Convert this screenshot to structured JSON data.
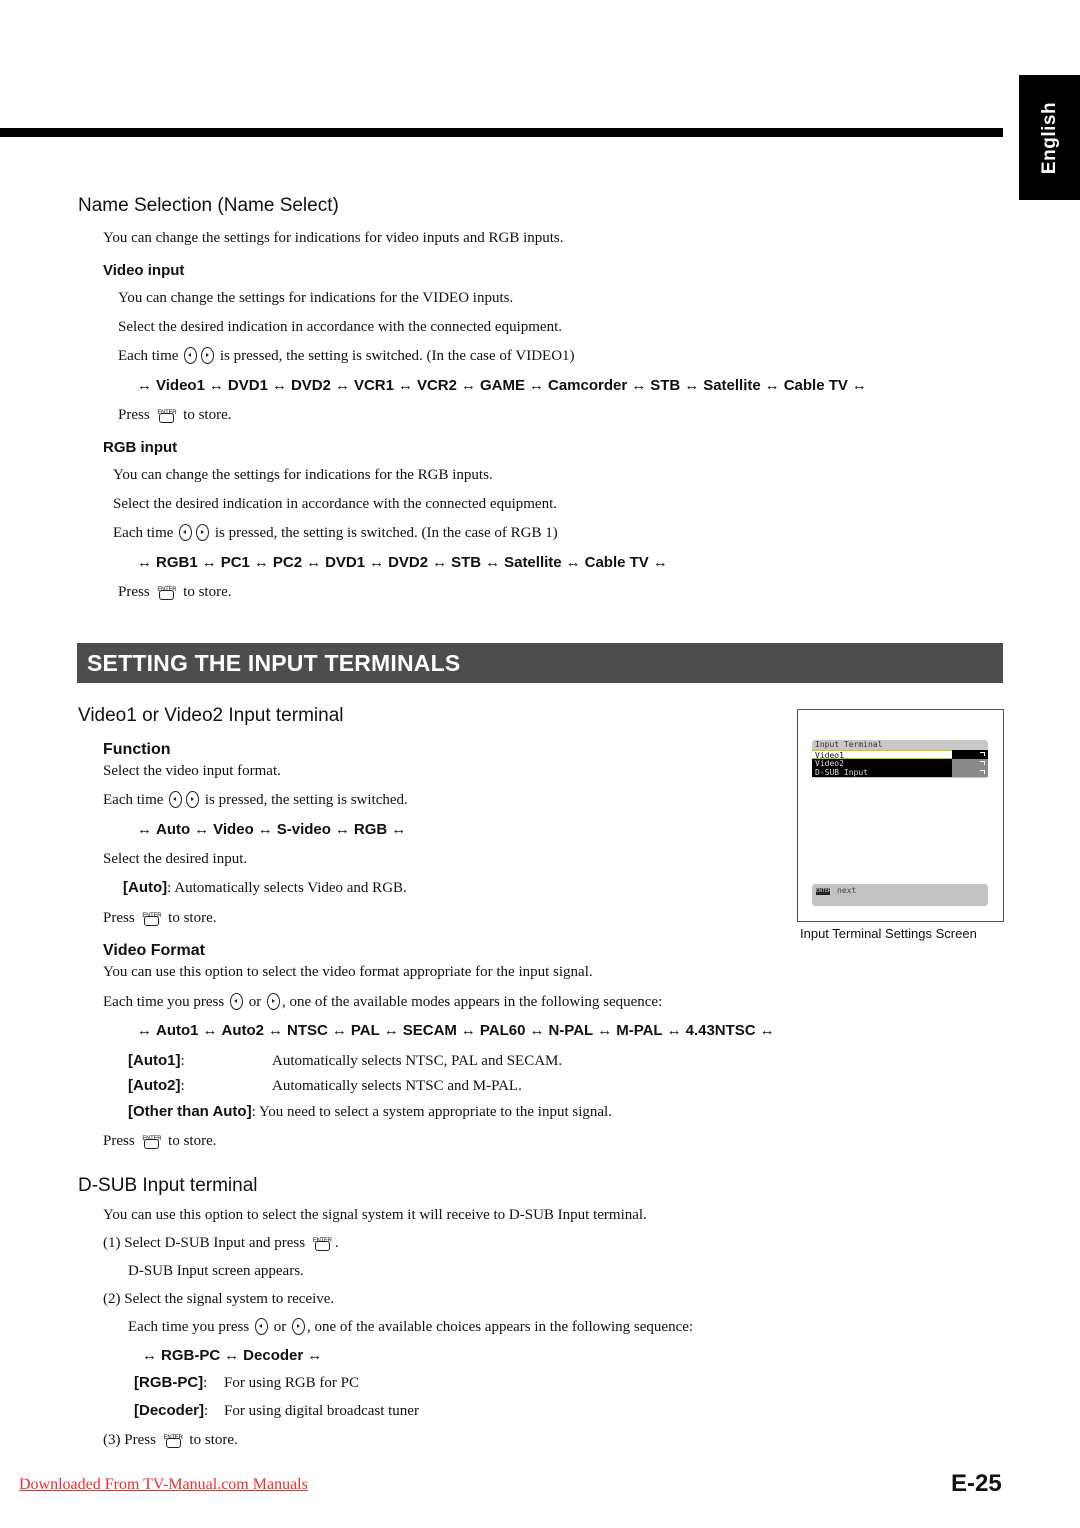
{
  "language_tab": "English",
  "name_selection": {
    "title": "Name Selection (Name Select)",
    "intro": "You can change the settings for indications for video inputs and RGB inputs.",
    "video_input": {
      "heading": "Video input",
      "line1": "You can change the settings for indications for the VIDEO inputs.",
      "line2": "Select the desired indication in accordance with the connected equipment.",
      "each_time_prefix": "Each time",
      "each_time_suffix": "is pressed, the setting is switched. (In the case of VIDEO1)",
      "sequence": [
        "Video1",
        "DVD1",
        "DVD2",
        "VCR1",
        "VCR2",
        "GAME",
        "Camcorder",
        "STB",
        "Satellite",
        "Cable TV"
      ],
      "press_prefix": "Press",
      "press_suffix": "to store."
    },
    "rgb_input": {
      "heading": "RGB input",
      "line1": "You can change the settings for indications for the RGB inputs.",
      "line2": "Select the desired indication in accordance with the connected equipment.",
      "each_time_prefix": "Each time",
      "each_time_suffix": "is pressed, the setting is switched. (In the case of RGB 1)",
      "sequence": [
        "RGB1",
        "PC1",
        "PC2",
        "DVD1",
        "DVD2",
        "STB",
        "Satellite",
        "Cable TV"
      ],
      "press_prefix": "Press",
      "press_suffix": "to store."
    }
  },
  "banner": "SETTING THE INPUT TERMINALS",
  "video_terminal": {
    "title": "Video1 or Video2 Input terminal",
    "function": {
      "heading": "Function",
      "line1": "Select the video input format.",
      "each_time_prefix": "Each time",
      "each_time_suffix": "is pressed, the setting is switched.",
      "sequence": [
        "Auto",
        "Video",
        "S-video",
        "RGB"
      ],
      "select_line": "Select the desired input.",
      "auto_term": "[Auto]",
      "auto_desc": ": Automatically selects Video and RGB.",
      "press_prefix": "Press",
      "press_suffix": "to store."
    },
    "video_format": {
      "heading": "Video Format",
      "line1": "You can use this option to select the video format appropriate for the input signal.",
      "each_time_prefix": "Each time you press",
      "or": "or",
      "each_time_suffix": ", one of the available modes appears in the following sequence:",
      "sequence": [
        "Auto1",
        "Auto2",
        "NTSC",
        "PAL",
        "SECAM",
        "PAL60",
        "N-PAL",
        "M-PAL",
        "4.43NTSC"
      ],
      "definitions": [
        {
          "term": "[Auto1]",
          "sep": ":",
          "desc": "Automatically selects NTSC, PAL and SECAM."
        },
        {
          "term": "[Auto2]",
          "sep": ":",
          "desc": "Automatically selects NTSC and M-PAL."
        },
        {
          "term": "[Other than Auto]",
          "sep": ":",
          "desc": "You need to select a system appropriate to the input signal."
        }
      ],
      "press_prefix": "Press",
      "press_suffix": "to store."
    }
  },
  "screen": {
    "menu_title": "Input Terminal",
    "rows": [
      "Video1",
      "Video2",
      "D-SUB Input"
    ],
    "enter_key": "ENTER",
    "hint": "next",
    "caption": "Input Terminal Settings Screen"
  },
  "dsub": {
    "title": "D-SUB Input terminal",
    "intro": "You can use this option to select the signal system it will receive to D-SUB Input terminal.",
    "step1_num": "(1)",
    "step1_prefix": "Select D-SUB Input and press",
    "step1_suffix": ".",
    "step1_note": "D-SUB Input screen appears.",
    "step2_num": "(2)",
    "step2": "Select the signal system to receive.",
    "each_time_prefix": "Each time you press",
    "or": "or",
    "each_time_suffix": ", one of the available choices appears in the following sequence:",
    "sequence": [
      "RGB-PC",
      "Decoder"
    ],
    "definitions": [
      {
        "term": "[RGB-PC]",
        "sep": ":",
        "desc": "For using RGB for PC"
      },
      {
        "term": "[Decoder]",
        "sep": ":",
        "desc": "For using digital broadcast tuner"
      }
    ],
    "step3_num": "(3)",
    "step3_prefix": "Press",
    "step3_suffix": "to store."
  },
  "icons": {
    "enter_label": "ENTER",
    "arrow": "↔"
  },
  "footer": {
    "link": "Downloaded From TV-Manual.com Manuals",
    "page": "E-25"
  },
  "colors": {
    "banner_bg": "#4d4d4d",
    "link": "#e4322f"
  }
}
